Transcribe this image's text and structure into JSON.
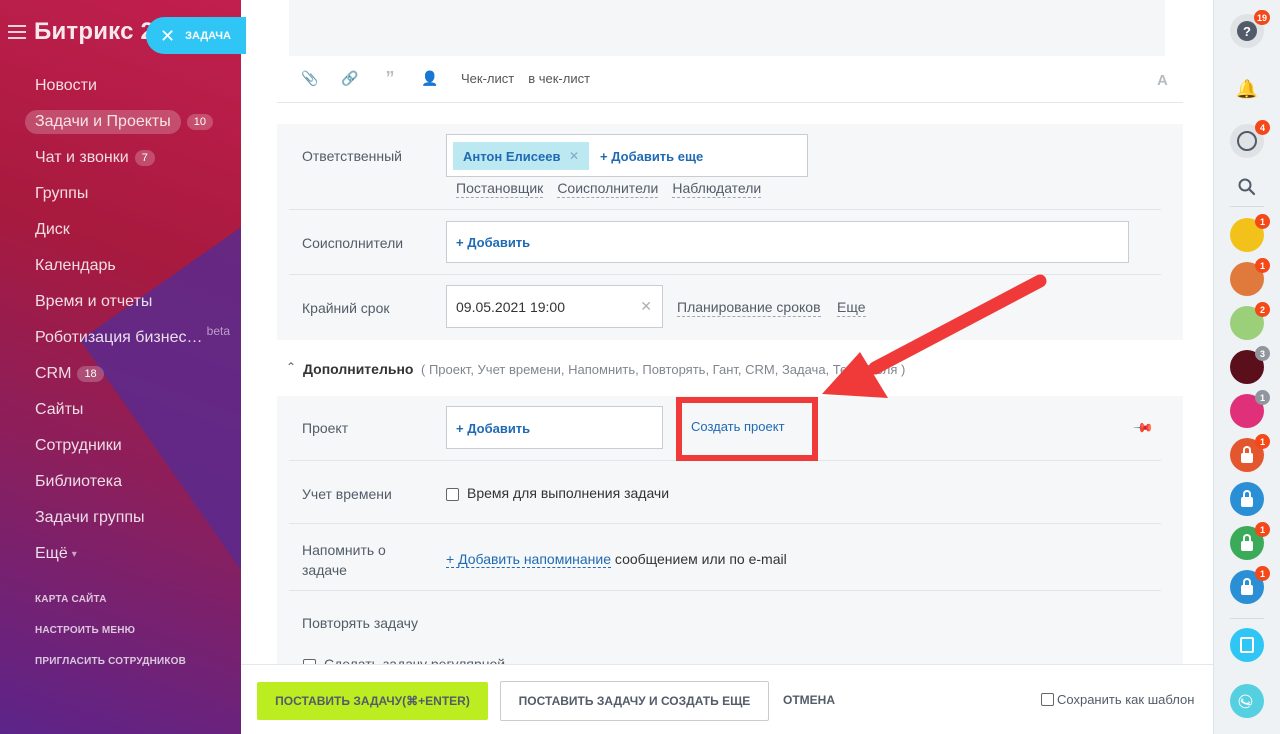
{
  "sidebar": {
    "logo": "Битрикс 24",
    "task_button": "ЗАДАЧА",
    "items": [
      {
        "label": "Новости",
        "count": ""
      },
      {
        "label": "Задачи и Проекты",
        "count": "10"
      },
      {
        "label": "Чат и звонки",
        "count": "7"
      },
      {
        "label": "Группы",
        "count": ""
      },
      {
        "label": "Диск",
        "count": ""
      },
      {
        "label": "Календарь",
        "count": ""
      },
      {
        "label": "Время и отчеты",
        "count": ""
      },
      {
        "label": "Роботизация бизнес…",
        "count": ""
      },
      {
        "label": "CRM",
        "count": "18"
      },
      {
        "label": "Сайты",
        "count": ""
      },
      {
        "label": "Сотрудники",
        "count": ""
      },
      {
        "label": "Библиотека",
        "count": ""
      },
      {
        "label": "Задачи группы",
        "count": ""
      },
      {
        "label": "Ещё",
        "count": ""
      }
    ],
    "beta": "beta",
    "links": [
      "КАРТА САЙТА",
      "НАСТРОИТЬ МЕНЮ",
      "ПРИГЛАСИТЬ СОТРУДНИКОВ"
    ]
  },
  "toolbar": {
    "checklist": "Чек-лист",
    "to_checklist": "в чек-лист",
    "font_icon": "A"
  },
  "form": {
    "responsible_label": "Ответственный",
    "responsible_chip": "Антон Елисеев",
    "add_more": "+ Добавить еще",
    "role_links": [
      "Постановщик",
      "Соисполнители",
      "Наблюдатели"
    ],
    "coexecutors_label": "Соисполнители",
    "add": "+ Добавить",
    "deadline_label": "Крайний срок",
    "deadline_value": "09.05.2021 19:00",
    "planning_link": "Планирование сроков",
    "more_link": "Еще",
    "additional_label": "Дополнительно",
    "additional_tags": "( Проект,  Учет времени,  Напомнить,  Повторять,  Гант,  CRM,  Задача,  Теги,  Поля )",
    "project_label": "Проект",
    "project_add": "+ Добавить",
    "create_project": "Создать проект",
    "time_label": "Учет времени",
    "time_checkbox": "Время для выполнения задачи",
    "remind_label": "Напомнить о задаче",
    "remind_link": "+ Добавить напоминание",
    "remind_text": " сообщением или по e-mail",
    "repeat_label": "Повторять задачу",
    "regular_checkbox": "Сделать задачу регулярной"
  },
  "footer": {
    "submit": "ПОСТАВИТЬ ЗАДАЧУ(⌘+ENTER)",
    "submit_more": "ПОСТАВИТЬ ЗАДАЧУ И СОЗДАТЬ ЕЩЕ",
    "cancel": "ОТМЕНА",
    "save_template": "Сохранить как шаблон"
  },
  "rightbar": {
    "help_badge": "19",
    "chat_badge": "4",
    "avatars": [
      {
        "badge": "1",
        "color": "#f2c21b"
      },
      {
        "badge": "1",
        "color": "#e07a3c"
      },
      {
        "badge": "2",
        "color": "#9ccf7a"
      },
      {
        "badge": "3",
        "color": "#5a0f1a"
      },
      {
        "badge": "1",
        "color": "#e0307a"
      },
      {
        "badge": "1",
        "color": "#e4572e"
      },
      {
        "badge": "",
        "color": "#2b8fd6"
      },
      {
        "badge": "1",
        "color": "#3bab5a"
      },
      {
        "badge": "1",
        "color": "#2b8fd6"
      }
    ]
  },
  "colors": {
    "accent_green": "#bbed21",
    "link_blue": "#1f6ab5",
    "highlight_red": "#f03a3a",
    "pill_blue": "#2fc6f6"
  }
}
